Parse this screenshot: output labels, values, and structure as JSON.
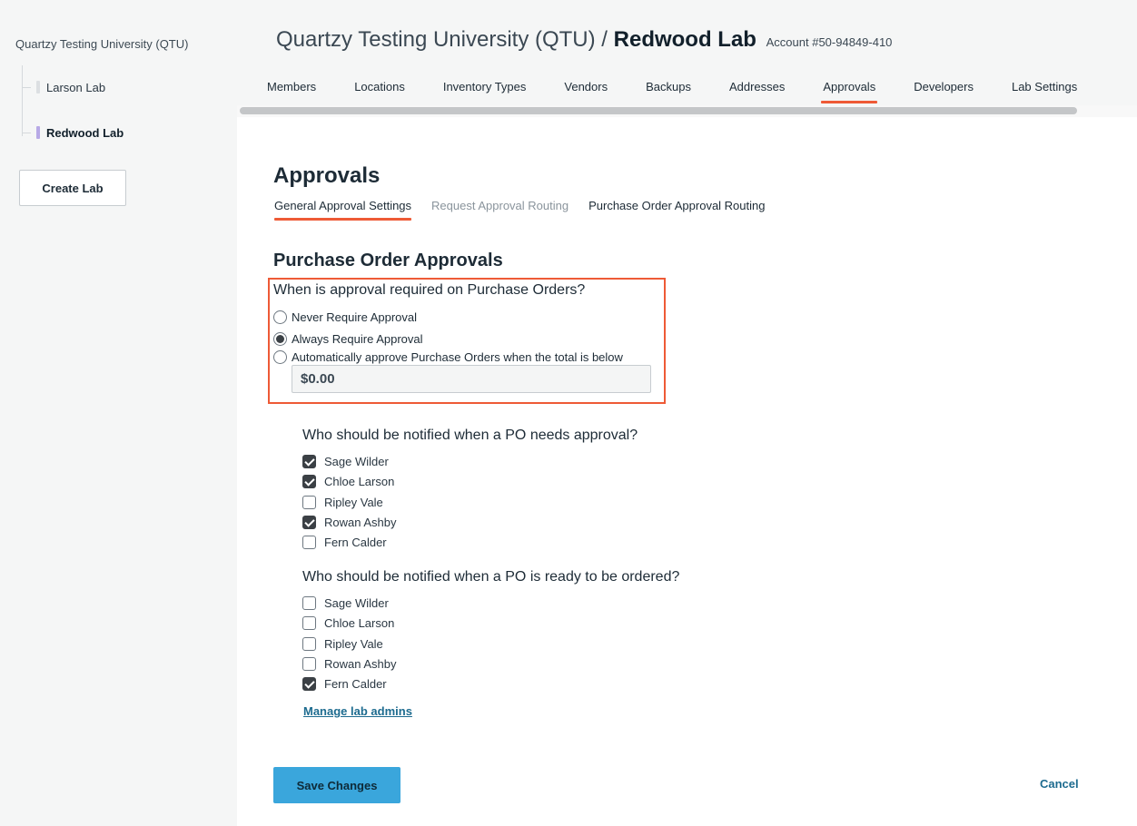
{
  "sidebar": {
    "org_name": "Quartzy Testing University (QTU)",
    "labs": [
      {
        "label": "Larson Lab",
        "active": false
      },
      {
        "label": "Redwood Lab",
        "active": true
      }
    ],
    "create_lab_label": "Create Lab"
  },
  "header": {
    "org": "Quartzy Testing University (QTU) /",
    "lab": "Redwood Lab",
    "account": "Account #50-94849-410"
  },
  "nav": {
    "tabs": [
      "Members",
      "Locations",
      "Inventory Types",
      "Vendors",
      "Backups",
      "Addresses",
      "Approvals",
      "Developers",
      "Lab Settings"
    ],
    "active": "Approvals"
  },
  "page": {
    "title": "Approvals",
    "subtabs": [
      "General Approval Settings",
      "Request Approval Routing",
      "Purchase Order Approval Routing"
    ],
    "active_subtab": "General Approval Settings"
  },
  "po_approvals": {
    "section_title": "Purchase Order Approvals",
    "question": "When is approval required on Purchase Orders?",
    "options": [
      {
        "label": "Never Require Approval",
        "selected": false
      },
      {
        "label": "Always Require Approval",
        "selected": true
      },
      {
        "label": "Automatically approve Purchase Orders when the total is below",
        "selected": false
      }
    ],
    "amount_value": "$0.00"
  },
  "notify_approval": {
    "question": "Who should be notified when a PO needs approval?",
    "people": [
      {
        "name": "Sage Wilder",
        "checked": true
      },
      {
        "name": "Chloe Larson",
        "checked": true
      },
      {
        "name": "Ripley Vale",
        "checked": false
      },
      {
        "name": "Rowan Ashby",
        "checked": true
      },
      {
        "name": "Fern Calder",
        "checked": false
      }
    ]
  },
  "notify_ready": {
    "question": "Who should be notified when a PO is ready to be ordered?",
    "people": [
      {
        "name": "Sage Wilder",
        "checked": false
      },
      {
        "name": "Chloe Larson",
        "checked": false
      },
      {
        "name": "Ripley Vale",
        "checked": false
      },
      {
        "name": "Rowan Ashby",
        "checked": false
      },
      {
        "name": "Fern Calder",
        "checked": true
      }
    ]
  },
  "footer": {
    "manage_link": "Manage lab admins",
    "save_label": "Save Changes",
    "cancel_label": "Cancel"
  },
  "colors": {
    "accent": "#ee5a36",
    "primary_button": "#3aa6dc",
    "link": "#1d6b8f"
  }
}
